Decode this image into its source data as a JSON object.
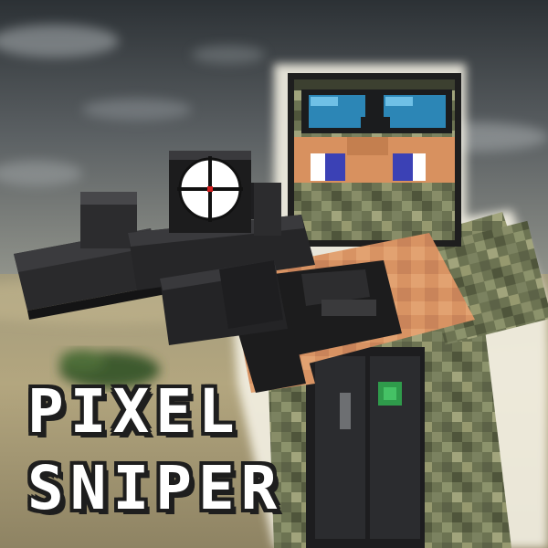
{
  "title": {
    "line1": "PIXEL",
    "line2": "SNIPER"
  },
  "colors": {
    "sky_top": "#2f3438",
    "sky_bottom": "#8d918c",
    "sand": "#b9ab84",
    "rifle_black": "#262628",
    "skin": "#d99566",
    "goggles": "#2c86b6",
    "eyes": "#3b41b5",
    "camo_base": "#6f7756",
    "scope_reticle_dot": "#d81e1e",
    "title_text": "#ffffff"
  }
}
